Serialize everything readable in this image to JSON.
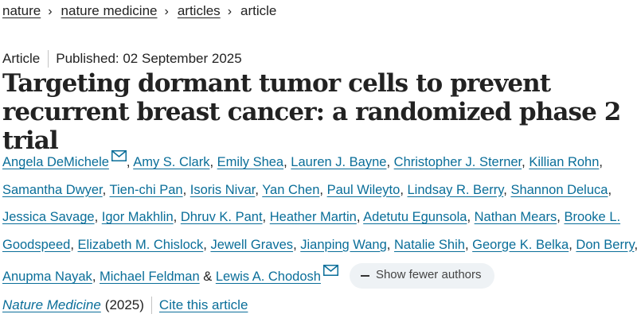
{
  "breadcrumb": {
    "items": [
      "nature",
      "nature medicine",
      "articles"
    ],
    "current": "article",
    "separator": "›"
  },
  "meta": {
    "type": "Article",
    "published": "Published: 02 September 2025"
  },
  "title": "Targeting dormant tumor cells to prevent recurrent breast cancer: a randomized phase 2 trial",
  "authors": {
    "list": [
      "Angela DeMichele",
      "Amy S. Clark",
      "Emily Shea",
      "Lauren J. Bayne",
      "Christopher J. Sterner",
      "Killian Rohn",
      "Samantha Dwyer",
      "Tien-chi Pan",
      "Isoris Nivar",
      "Yan Chen",
      "Paul Wileyto",
      "Lindsay R. Berry",
      "Shannon Deluca",
      "Jessica Savage",
      "Igor Makhlin",
      "Dhruv K. Pant",
      "Heather Martin",
      "Adetutu Egunsola",
      "Nathan Mears",
      "Brooke L. Goodspeed",
      "Elizabeth M. Chislock",
      "Jewell Graves",
      "Jianping Wang",
      "Natalie Shih",
      "George K. Belka",
      "Don Berry",
      "Anupma Nayak",
      "Michael Feldman",
      "Lewis A. Chodosh"
    ],
    "separator": ",",
    "conjunction": "&",
    "show_fewer_label": "Show fewer authors"
  },
  "citation": {
    "journal": "Nature Medicine",
    "year": "(2025)",
    "cite_label": "Cite this article"
  },
  "colors": {
    "link": "#0a6e99",
    "text": "#222222",
    "pill_bg": "#eef2f5"
  }
}
